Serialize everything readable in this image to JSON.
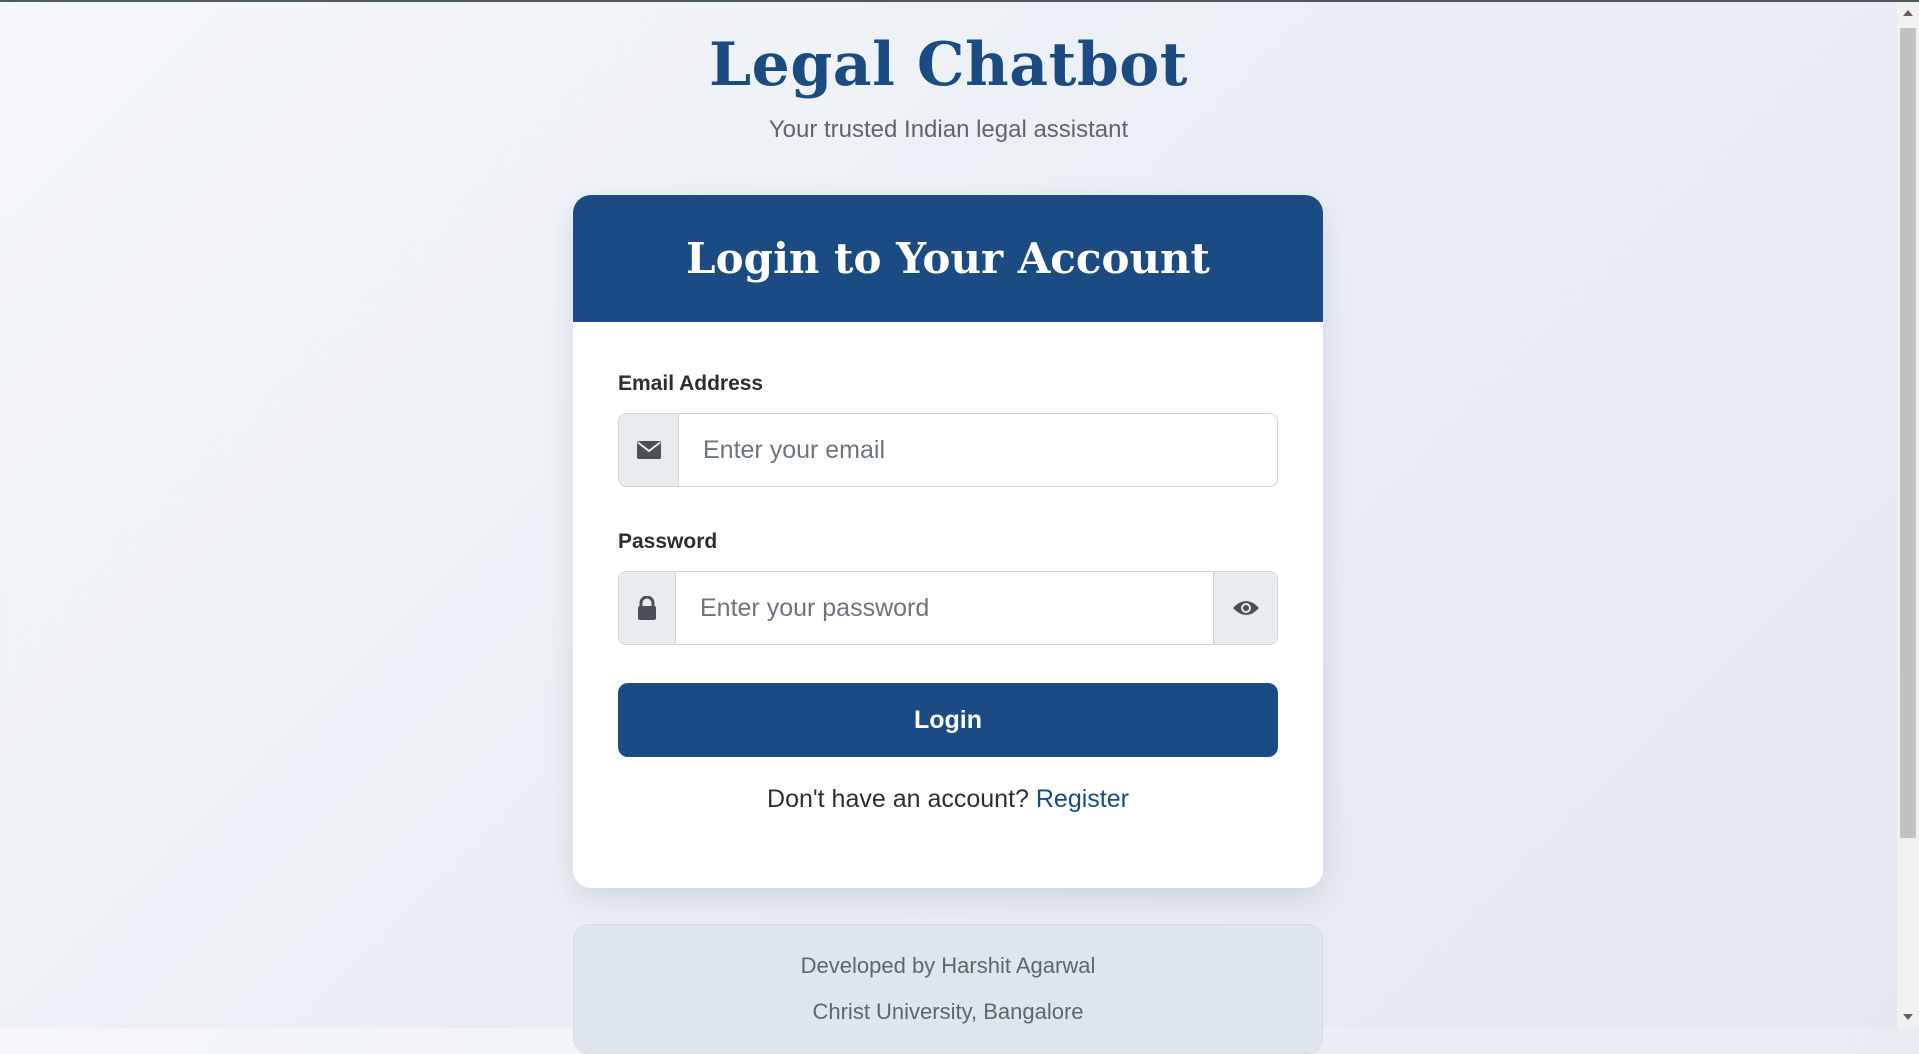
{
  "header": {
    "title": "Legal Chatbot",
    "subtitle": "Your trusted Indian legal assistant"
  },
  "card": {
    "heading": "Login to Your Account",
    "email": {
      "label": "Email Address",
      "placeholder": "Enter your email",
      "value": "",
      "icon": "envelope-icon"
    },
    "password": {
      "label": "Password",
      "placeholder": "Enter your password",
      "value": "",
      "icon": "lock-icon",
      "toggle_icon": "eye-icon"
    },
    "login_label": "Login",
    "register_prompt": "Don't have an account?",
    "register_link": "Register"
  },
  "footer": {
    "line1": "Developed by Harshit Agarwal",
    "line2": "Christ University, Bangalore"
  },
  "colors": {
    "primary": "#1a4b82",
    "background": "#eef1f6",
    "footer_bg": "#dfe5ee"
  }
}
